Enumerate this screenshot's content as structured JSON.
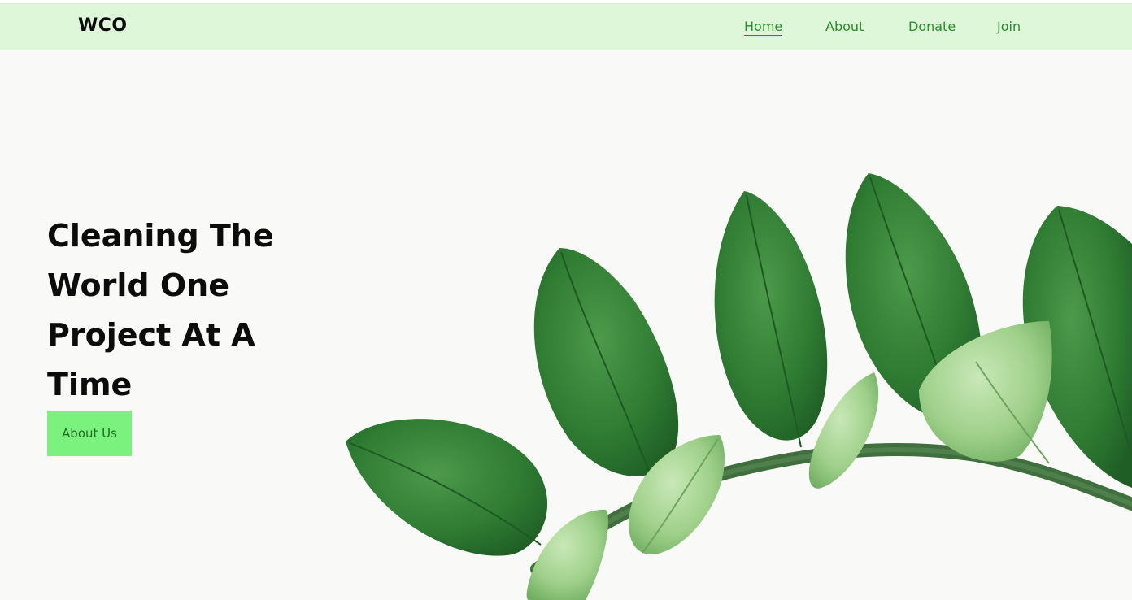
{
  "brand": {
    "logo_text": "WCO"
  },
  "nav": {
    "items": [
      {
        "label": "Home",
        "active": true
      },
      {
        "label": "About",
        "active": false
      },
      {
        "label": "Donate",
        "active": false
      },
      {
        "label": "Join",
        "active": false
      }
    ]
  },
  "hero": {
    "title": "Cleaning The World One Project At A Time",
    "button_label": "About Us",
    "image": "green-leaves-branch"
  },
  "colors": {
    "navbar_bg": "#ddf7d8",
    "nav_link": "#2a8a2e",
    "button_bg": "#7cf27e",
    "button_text": "#1d6b20",
    "page_bg": "#f9f9f8"
  }
}
